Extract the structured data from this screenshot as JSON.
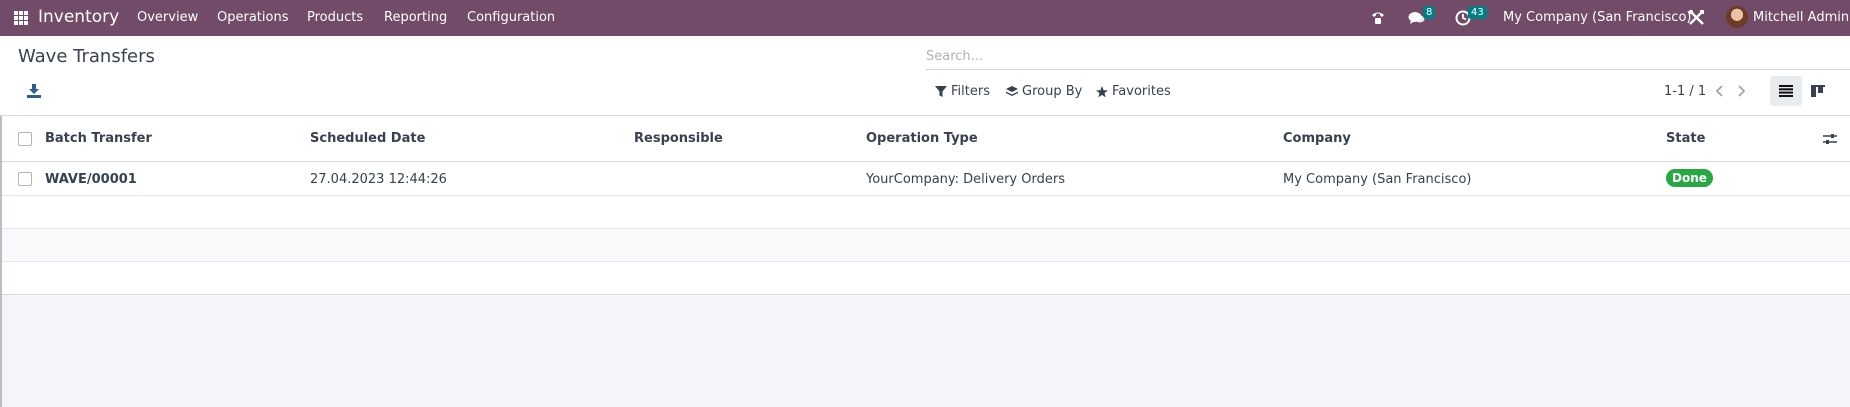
{
  "navbar": {
    "app_name": "Inventory",
    "menu": [
      "Overview",
      "Operations",
      "Products",
      "Reporting",
      "Configuration"
    ],
    "messages_count": "8",
    "activities_count": "43",
    "company": "My Company (San Francisco)",
    "user": "Mitchell Admin",
    "bg_color": "#714b67"
  },
  "control_panel": {
    "title": "Wave Transfers",
    "search_placeholder": "Search...",
    "filters_label": "Filters",
    "group_by_label": "Group By",
    "favorites_label": "Favorites",
    "pager": "1-1 / 1"
  },
  "list": {
    "columns": [
      "Batch Transfer",
      "Scheduled Date",
      "Responsible",
      "Operation Type",
      "Company",
      "State"
    ],
    "rows": [
      {
        "batch_transfer": "WAVE/00001",
        "scheduled_date": "27.04.2023 12:44:26",
        "responsible": "",
        "operation_type": "YourCompany: Delivery Orders",
        "company": "My Company (San Francisco)",
        "state": "Done"
      }
    ],
    "done_color": "#28a745"
  },
  "icons": {
    "apps": "apps-grid-icon",
    "phone": "phone-icon",
    "chat": "chat-icon",
    "clock": "clock-icon",
    "tools": "tools-icon",
    "download": "download-icon",
    "search": "search-icon",
    "filter": "filter-icon",
    "layers": "layers-icon",
    "star": "star-icon",
    "list_view": "list-view-icon",
    "kanban_view": "kanban-view-icon",
    "optional_columns": "sliders-icon"
  }
}
